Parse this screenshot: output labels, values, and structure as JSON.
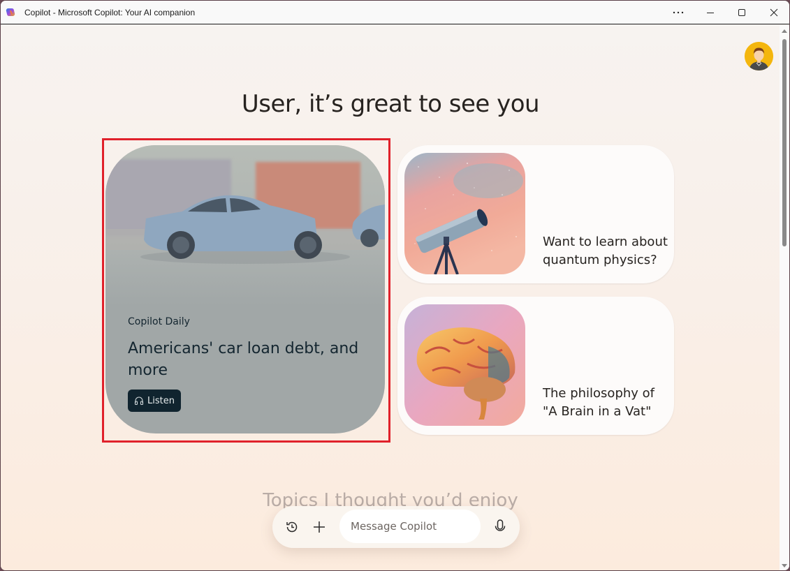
{
  "window": {
    "title": "Copilot - Microsoft Copilot: Your AI companion",
    "controls": {
      "more": "more-options",
      "minimize": "minimize",
      "maximize": "maximize",
      "close": "close"
    }
  },
  "header": {
    "avatar_icon": "user-avatar"
  },
  "greeting": "User, it’s great to see you",
  "daily_card": {
    "label": "Copilot Daily",
    "title": "Americans' car loan debt, and more",
    "listen_label": "Listen",
    "listen_icon": "headphones-icon"
  },
  "topic_cards": [
    {
      "text": "Want to learn about quantum physics?",
      "image": "telescope-illustration"
    },
    {
      "text": "The philosophy of \"A Brain in a Vat\"",
      "image": "brain-illustration"
    }
  ],
  "topics_heading": "Topics I thought you’d enjoy",
  "composer": {
    "placeholder": "Message Copilot",
    "history_icon": "history-icon",
    "add_icon": "plus-icon",
    "mic_icon": "microphone-icon"
  },
  "colors": {
    "highlight": "#e0212b",
    "listen_button": "#10242f",
    "daily_card_bg": "#a1a7a7"
  }
}
